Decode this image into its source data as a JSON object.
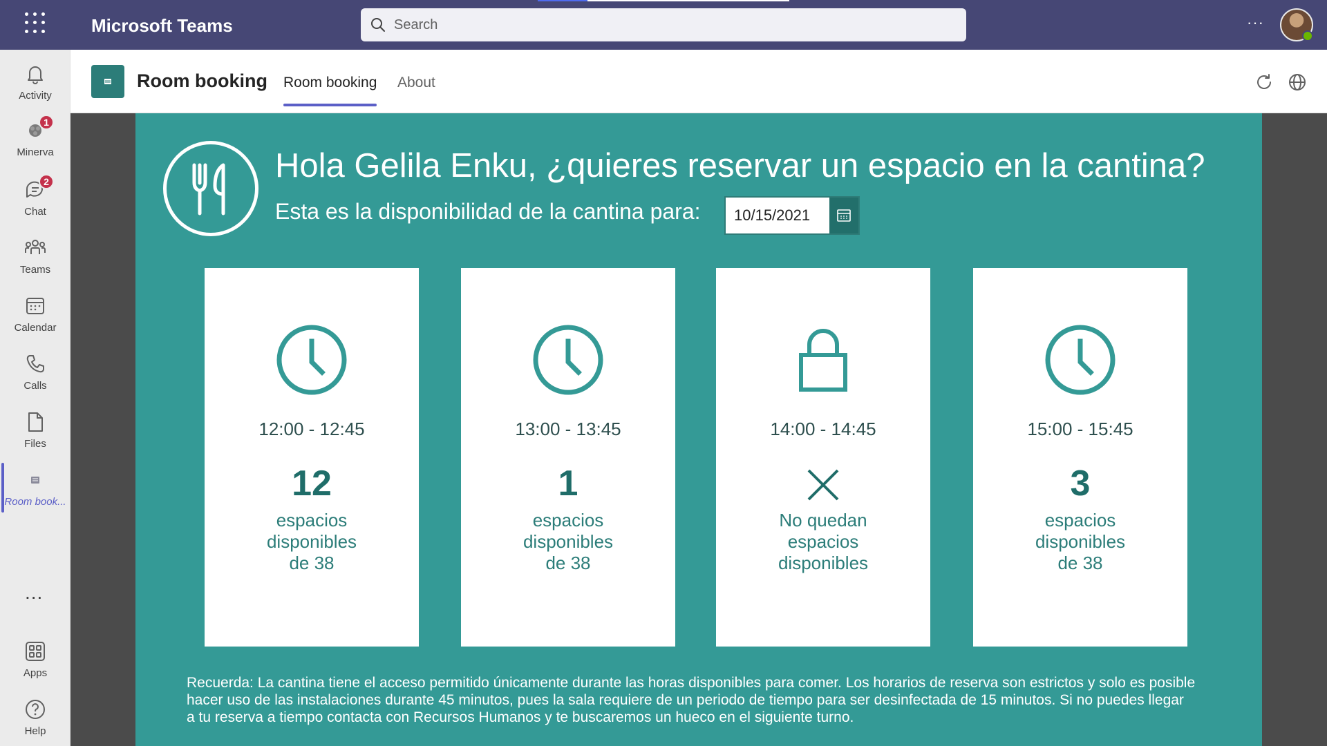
{
  "app": {
    "title": "Microsoft Teams",
    "search_placeholder": "Search"
  },
  "rail": {
    "items": [
      {
        "label": "Activity",
        "icon": "bell-icon"
      },
      {
        "label": "Minerva",
        "icon": "minerva-icon",
        "badge": "1"
      },
      {
        "label": "Chat",
        "icon": "chat-icon",
        "badge": "2"
      },
      {
        "label": "Teams",
        "icon": "teams-icon"
      },
      {
        "label": "Calendar",
        "icon": "calendar-icon"
      },
      {
        "label": "Calls",
        "icon": "phone-icon"
      },
      {
        "label": "Files",
        "icon": "file-icon"
      },
      {
        "label": "Room book...",
        "icon": "room-booking-icon"
      }
    ],
    "more": "...",
    "bottom": [
      {
        "label": "Apps",
        "icon": "apps-icon"
      },
      {
        "label": "Help",
        "icon": "help-icon"
      }
    ]
  },
  "header": {
    "app_name": "Room booking",
    "tabs": [
      {
        "label": "Room booking",
        "active": true
      },
      {
        "label": "About",
        "active": false
      }
    ]
  },
  "main": {
    "greeting": "Hola Gelila Enku, ¿quieres reservar un espacio en la cantina?",
    "availability_label": "Esta es la disponibilidad de la cantina para:",
    "date": "10/15/2021",
    "slots": [
      {
        "time": "12:00 - 12:45",
        "count": "12",
        "line1": "espacios",
        "line2": "disponibles",
        "line3": "de 38",
        "icon": "clock-icon"
      },
      {
        "time": "13:00 - 13:45",
        "count": "1",
        "line1": "espacios",
        "line2": "disponibles",
        "line3": "de 38",
        "icon": "clock-icon"
      },
      {
        "time": "14:00 - 14:45",
        "count": "",
        "line1": "No quedan",
        "line2": "espacios",
        "line3": "disponibles",
        "icon": "lock-icon"
      },
      {
        "time": "15:00 - 15:45",
        "count": "3",
        "line1": "espacios",
        "line2": "disponibles",
        "line3": "de 38",
        "icon": "clock-icon"
      }
    ],
    "note": "Recuerda: La cantina tiene el acceso permitido únicamente durante las horas disponibles para comer. Los horarios de reserva son estrictos y solo es posible hacer uso de las instalaciones durante 45 minutos, pues la sala requiere de un periodo de tiempo para ser desinfectada de 15 minutos. Si no puedes llegar a tu reserva a tiempo contacta con Recursos Humanos y te buscaremos un hueco en el siguiente turno."
  },
  "colors": {
    "teams_bar": "#464775",
    "accent": "#5b5fc7",
    "teal": "#349a96",
    "teal_dark": "#1f6d69",
    "badge": "#c4314b"
  }
}
